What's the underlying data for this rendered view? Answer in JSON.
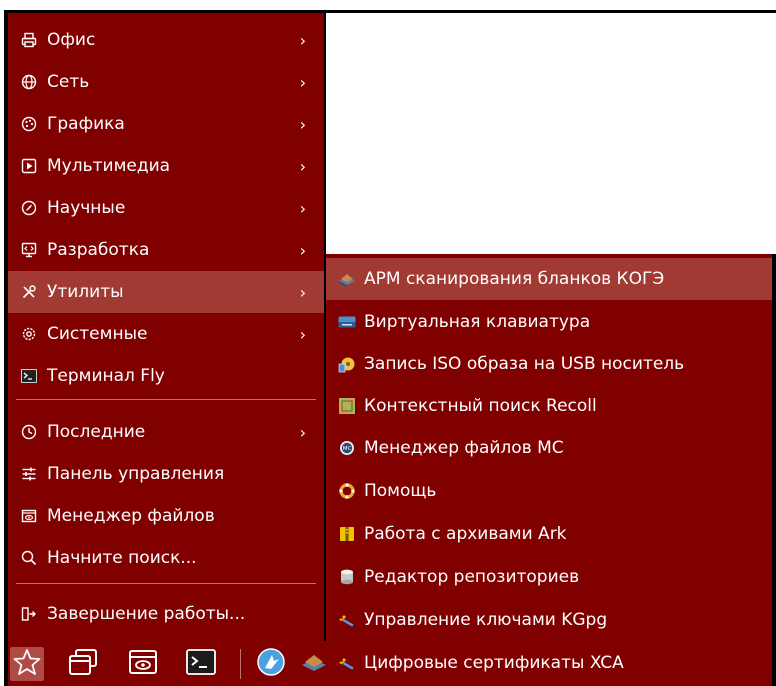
{
  "main_menu": {
    "items": [
      {
        "label": "Офис",
        "icon": "printer-icon",
        "has_submenu": true
      },
      {
        "label": "Сеть",
        "icon": "globe-icon",
        "has_submenu": true
      },
      {
        "label": "Графика",
        "icon": "palette-icon",
        "has_submenu": true
      },
      {
        "label": "Мультимедиа",
        "icon": "play-icon",
        "has_submenu": true
      },
      {
        "label": "Научные",
        "icon": "compass-icon",
        "has_submenu": true
      },
      {
        "label": "Разработка",
        "icon": "code-icon",
        "has_submenu": true
      },
      {
        "label": "Утилиты",
        "icon": "tools-icon",
        "has_submenu": true,
        "active": true
      },
      {
        "label": "Системные",
        "icon": "gear-icon",
        "has_submenu": true
      },
      {
        "label": "Терминал Fly",
        "icon": "terminal-icon",
        "has_submenu": false
      },
      {
        "label": "Последние",
        "icon": "clock-icon",
        "has_submenu": true
      },
      {
        "label": "Панель управления",
        "icon": "sliders-icon",
        "has_submenu": false
      },
      {
        "label": "Менеджер файлов",
        "icon": "file-manager-icon",
        "has_submenu": false
      },
      {
        "label": "Начните поиск...",
        "icon": "search-icon",
        "has_submenu": false
      },
      {
        "label": "Завершение работы...",
        "icon": "logout-icon",
        "has_submenu": false
      }
    ],
    "chevron": "›"
  },
  "submenu": {
    "items": [
      {
        "label": "АРМ сканирования бланков КОГЭ",
        "icon": "scanner-icon",
        "active": true
      },
      {
        "label": "Виртуальная клавиатура",
        "icon": "keyboard-icon"
      },
      {
        "label": "Запись ISO образа на USB носитель",
        "icon": "usb-writer-icon"
      },
      {
        "label": "Контекстный поиск Recoll",
        "icon": "recoll-icon"
      },
      {
        "label": "Менеджер файлов MC",
        "icon": "mc-icon"
      },
      {
        "label": "Помощь",
        "icon": "help-lifebuoy-icon"
      },
      {
        "label": "Работа с архивами Ark",
        "icon": "archive-icon"
      },
      {
        "label": "Редактор репозиториев",
        "icon": "database-icon"
      },
      {
        "label": "Управление ключами KGpg",
        "icon": "key-icon"
      },
      {
        "label": "Цифровые сертификаты XCA",
        "icon": "certificate-icon"
      }
    ]
  },
  "taskbar": {
    "icons": [
      "star-icon",
      "windows-icon",
      "eye-icon",
      "terminal-icon",
      "fly-icon"
    ]
  },
  "colors": {
    "menu_bg": "#800000",
    "highlight": "#a03a33",
    "text": "#ffffff"
  }
}
